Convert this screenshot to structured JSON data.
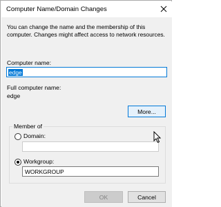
{
  "window": {
    "title": "Computer Name/Domain Changes",
    "close_icon": "close-icon"
  },
  "description": "You can change the name and the membership of this computer. Changes might affect access to network resources.",
  "computer_name": {
    "label": "Computer name:",
    "value": "edge"
  },
  "full_computer_name": {
    "label": "Full computer name:",
    "value": "edge"
  },
  "more_button": {
    "label": "More..."
  },
  "member_of": {
    "label": "Member of",
    "domain": {
      "label": "Domain:",
      "value": "",
      "selected": false
    },
    "workgroup": {
      "label": "Workgroup:",
      "value": "WORKGROUP",
      "selected": true
    }
  },
  "buttons": {
    "ok": "OK",
    "cancel": "Cancel"
  },
  "colors": {
    "accent": "#0078d7",
    "body_bg": "#f0f0f0"
  }
}
